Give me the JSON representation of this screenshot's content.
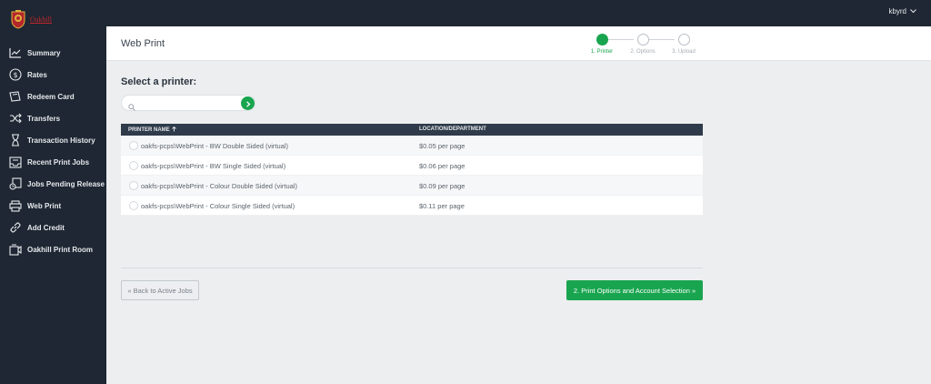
{
  "brand": {
    "logo_text": "Oakhill",
    "accent": "#c1272d"
  },
  "colors": {
    "primary": "#19a54f",
    "sidebar": "#1e2733",
    "table_header": "#2f3b4a"
  },
  "user": {
    "name": "kbyrd"
  },
  "sidebar": {
    "items": [
      {
        "label": "Summary",
        "icon": "chart-line-icon"
      },
      {
        "label": "Rates",
        "icon": "dollar-icon"
      },
      {
        "label": "Redeem Card",
        "icon": "card-icon"
      },
      {
        "label": "Transfers",
        "icon": "shuffle-icon"
      },
      {
        "label": "Transaction History",
        "icon": "hourglass-icon"
      },
      {
        "label": "Recent Print Jobs",
        "icon": "inbox-icon"
      },
      {
        "label": "Jobs Pending Release",
        "icon": "pending-doc-icon"
      },
      {
        "label": "Web Print",
        "icon": "printer-icon"
      },
      {
        "label": "Add Credit",
        "icon": "link-icon"
      },
      {
        "label": "Oakhill Print Room",
        "icon": "print-room-icon"
      }
    ]
  },
  "header": {
    "title": "Web Print",
    "steps": [
      {
        "label": "1. Printer",
        "active": true
      },
      {
        "label": "2. Options",
        "active": false
      },
      {
        "label": "3. Upload",
        "active": false
      }
    ]
  },
  "main": {
    "select_title": "Select a printer:",
    "search": {
      "value": "",
      "placeholder": ""
    },
    "table": {
      "columns": {
        "name": "PRINTER NAME",
        "location": "LOCATION/DEPARTMENT"
      },
      "rows": [
        {
          "name": "oakfs-pcps\\WebPrint - BW Double Sided (virtual)",
          "location": "$0.05 per page"
        },
        {
          "name": "oakfs-pcps\\WebPrint - BW Single Sided (virtual)",
          "location": "$0.06 per page"
        },
        {
          "name": "oakfs-pcps\\WebPrint - Colour Double Sided (virtual)",
          "location": "$0.09 per page"
        },
        {
          "name": "oakfs-pcps\\WebPrint - Colour Single Sided (virtual)",
          "location": "$0.11 per page"
        }
      ]
    },
    "back_button": "« Back to Active Jobs",
    "next_button": "2. Print Options and Account Selection »"
  }
}
